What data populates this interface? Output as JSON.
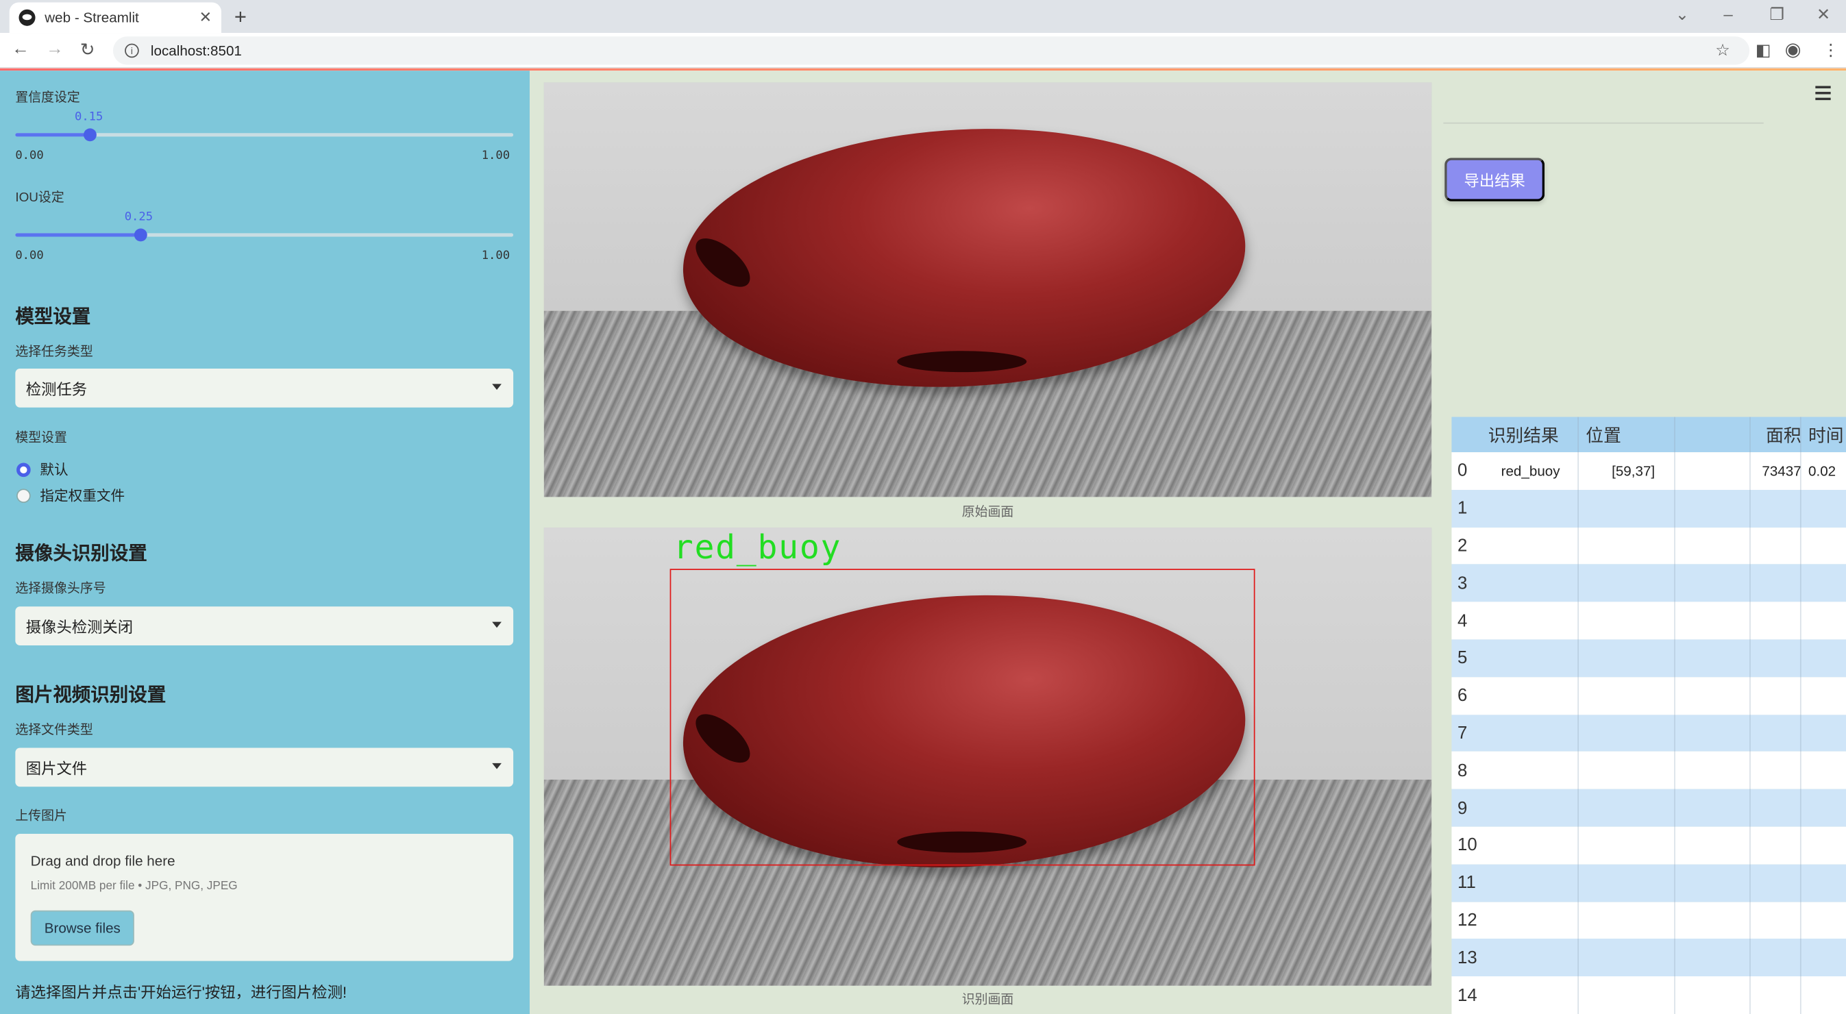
{
  "browser": {
    "tab_title": "web - Streamlit",
    "tab_close": "✕",
    "new_tab": "+",
    "url": "localhost:8501"
  },
  "sidebar": {
    "confidence": {
      "label": "置信度设定",
      "value": "0.15",
      "min": "0.00",
      "max": "1.00",
      "fraction": 0.15
    },
    "iou": {
      "label": "IOU设定",
      "value": "0.25",
      "min": "0.00",
      "max": "1.00",
      "fraction": 0.25
    },
    "model_section": "模型设置",
    "task_type_label": "选择任务类型",
    "task_type_value": "检测任务",
    "model_setting_label": "模型设置",
    "model_options": [
      "默认",
      "指定权重文件"
    ],
    "model_selected": 0,
    "camera_section": "摄像头识别设置",
    "camera_label": "选择摄像头序号",
    "camera_value": "摄像头检测关闭",
    "media_section": "图片视频识别设置",
    "file_type_label": "选择文件类型",
    "file_type_value": "图片文件",
    "upload_label": "上传图片",
    "upload_drag": "Drag and drop file here",
    "upload_limit": "Limit 200MB per file • JPG, PNG, JPEG",
    "browse_button": "Browse files",
    "footer_note": "请选择图片并点击'开始运行'按钮，进行图片检测!"
  },
  "main": {
    "original_caption": "原始画面",
    "result_caption": "识别画面",
    "detection_label": "red_buoy",
    "export_button": "导出结果"
  },
  "table": {
    "headers": [
      "",
      "识别结果",
      "位置",
      "面积",
      "时间"
    ],
    "rows": [
      [
        "0",
        "red_buoy",
        "[59,37]",
        "73437",
        "0.02"
      ],
      [
        "1",
        "",
        "",
        "",
        ""
      ],
      [
        "2",
        "",
        "",
        "",
        ""
      ],
      [
        "3",
        "",
        "",
        "",
        ""
      ],
      [
        "4",
        "",
        "",
        "",
        ""
      ],
      [
        "5",
        "",
        "",
        "",
        ""
      ],
      [
        "6",
        "",
        "",
        "",
        ""
      ],
      [
        "7",
        "",
        "",
        "",
        ""
      ],
      [
        "8",
        "",
        "",
        "",
        ""
      ],
      [
        "9",
        "",
        "",
        "",
        ""
      ],
      [
        "10",
        "",
        "",
        "",
        ""
      ],
      [
        "11",
        "",
        "",
        "",
        ""
      ],
      [
        "12",
        "",
        "",
        "",
        ""
      ],
      [
        "13",
        "",
        "",
        "",
        ""
      ],
      [
        "14",
        "",
        "",
        "",
        ""
      ]
    ]
  },
  "colors": {
    "sidebar_bg": "#7ec7da",
    "main_bg": "#dde7d6",
    "accent": "#4a60e8",
    "export_button": "#8b8df0",
    "detection_box": "#e01818",
    "detection_text": "#22dd22"
  }
}
